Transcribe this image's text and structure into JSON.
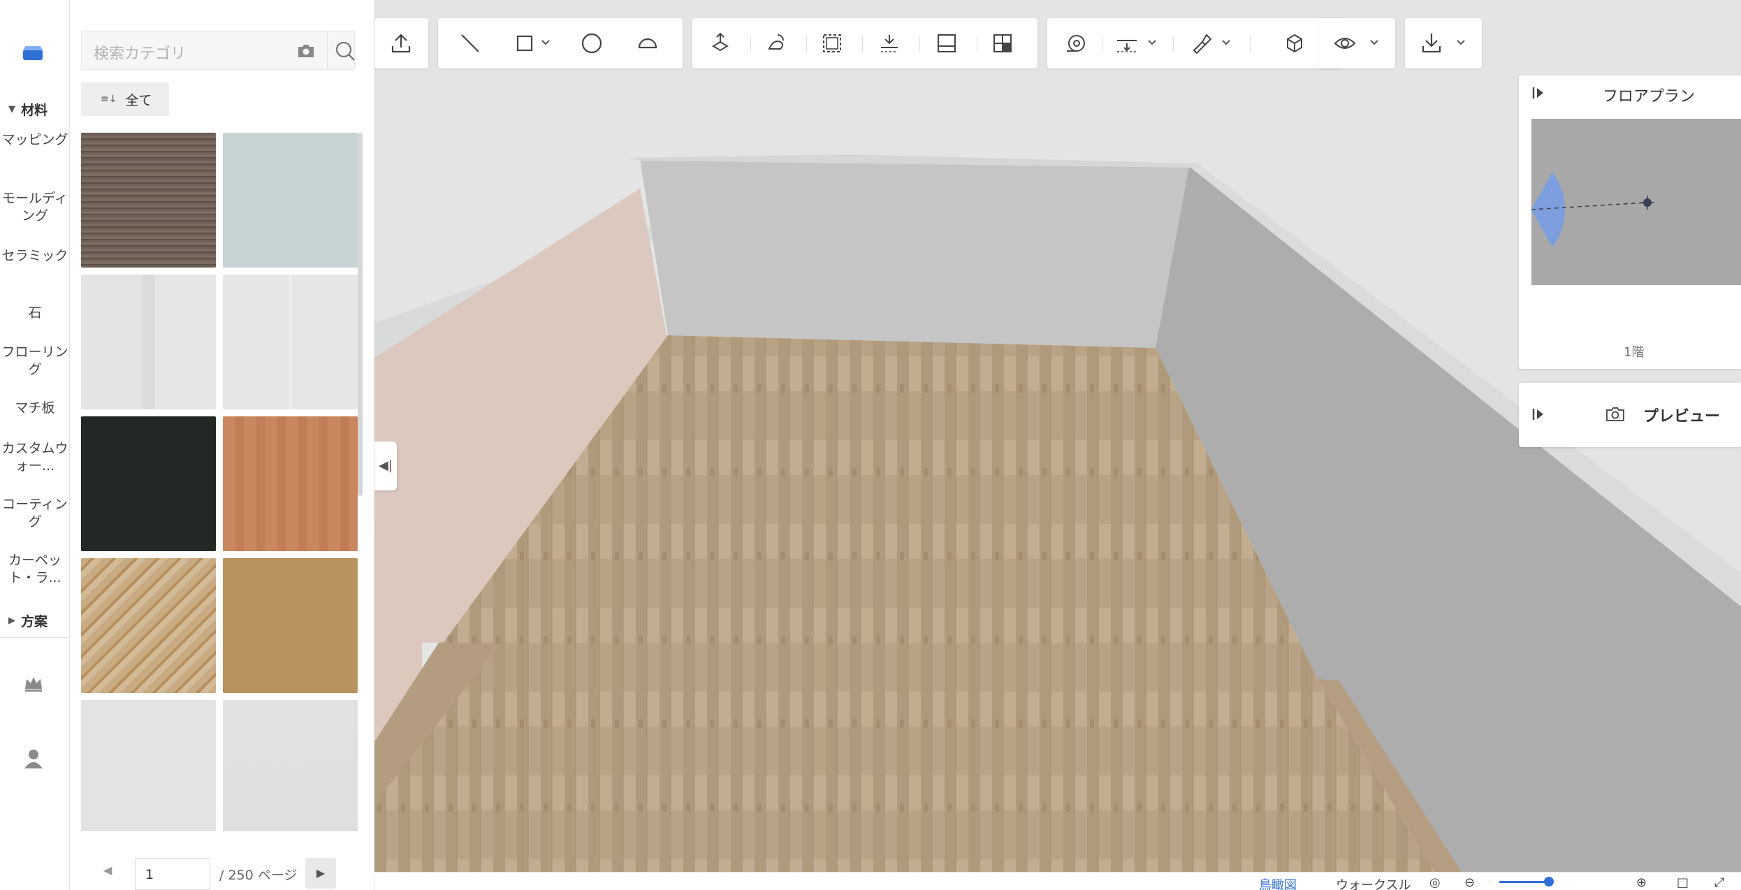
{
  "search": {
    "placeholder": "検索カテゴリ"
  },
  "filter": {
    "label": "全て"
  },
  "rail": {
    "section_materials": "材料",
    "items": [
      "マッピング",
      "モールディング",
      "セラミック",
      "石",
      "フローリング",
      "マチ板",
      "カスタムウォー...",
      "コーティング",
      "カーペット・ラ..."
    ],
    "section_plans": "方案"
  },
  "materials": [
    {
      "name": "dark-wood",
      "color": "#6b5d52"
    },
    {
      "name": "light-blue-gray",
      "color": "#c7d3d5"
    },
    {
      "name": "light-gray",
      "color": "#e4e4e4"
    },
    {
      "name": "light-gray-lines",
      "color": "#e6e7e7"
    },
    {
      "name": "black",
      "color": "#222823"
    },
    {
      "name": "terracotta",
      "color": "#c88661"
    },
    {
      "name": "patterned-beige",
      "color": "#c5a57b"
    },
    {
      "name": "tan-wood",
      "color": "#b8925f"
    },
    {
      "name": "speckled-white",
      "color": "#e2e4e4"
    },
    {
      "name": "pale-gray",
      "color": "#e0e2e4"
    }
  ],
  "pager": {
    "current": "1",
    "total": "/ 250 ページ"
  },
  "floorplan": {
    "title": "フロアプラン",
    "level": "1階"
  },
  "preview": {
    "title": "プレビュー"
  },
  "bottom": {
    "view1": "鳥瞰図",
    "view2": "ウォークスル"
  },
  "colors": {
    "accent": "#2f6fd6",
    "camera_fov": "#7d9fe0",
    "floor": "#b59f82"
  }
}
